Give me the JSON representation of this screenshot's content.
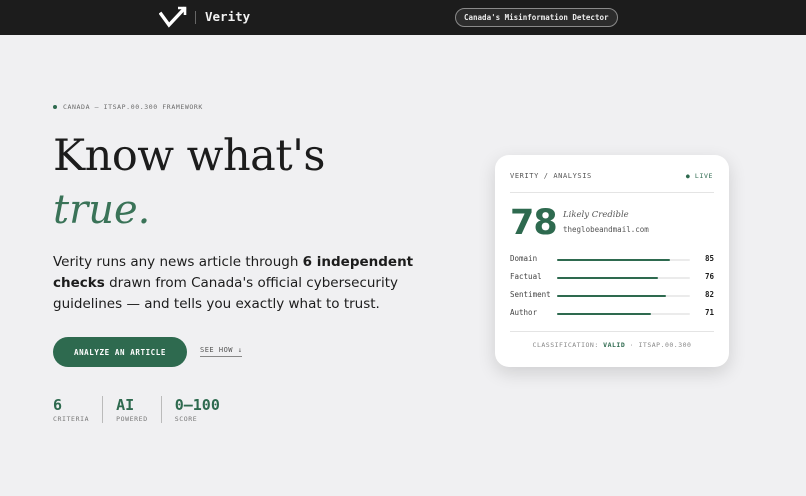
{
  "header": {
    "brand": "Verity",
    "tagline": "Canada's Misinformation Detector",
    "logo_icon": "check-arrow-icon"
  },
  "hero": {
    "eyebrow": "CANADA — ITSAP.00.300 FRAMEWORK",
    "headline_line1": "Know what's",
    "headline_line2": "true.",
    "desc_part1": "Verity runs any news article through ",
    "desc_bold": "6 independent checks",
    "desc_part2": " drawn from Canada's official cybersecurity guidelines — and tells you exactly what to trust.",
    "cta_label": "ANALYZE AN ARTICLE",
    "secondary_link": "SEE HOW ↓",
    "stats": [
      {
        "value": "6",
        "label": "CRITERIA"
      },
      {
        "value": "AI",
        "label": "POWERED"
      },
      {
        "value": "0–100",
        "label": "SCORE"
      }
    ]
  },
  "card": {
    "header": "VERITY / ANALYSIS",
    "live": "● LIVE",
    "score": "78",
    "verdict": "Likely Credible",
    "domain": "theglobeandmail.com",
    "metrics": [
      {
        "label": "Domain",
        "value": "85",
        "fill": 0.85
      },
      {
        "label": "Factual",
        "value": "76",
        "fill": 0.76
      },
      {
        "label": "Sentiment",
        "value": "82",
        "fill": 0.82
      },
      {
        "label": "Author",
        "value": "71",
        "fill": 0.71
      }
    ],
    "classification_prefix": "CLASSIFICATION: ",
    "classification_value": "VALID",
    "classification_suffix": " · ITSAP.00.300"
  },
  "colors": {
    "accent": "#2e6a4f",
    "accent_light": "#3a7358",
    "topbar": "#1c1c1c",
    "background": "#f0f0f2"
  }
}
